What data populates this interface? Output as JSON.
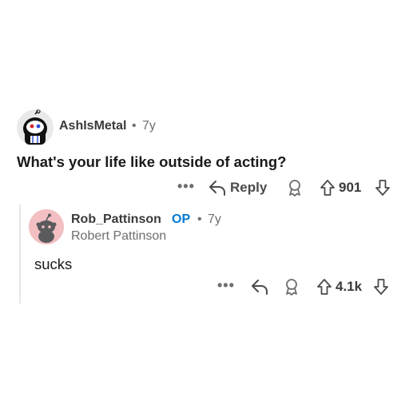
{
  "comment": {
    "author": "AshIsMetal",
    "separator": "•",
    "age": "7y",
    "body": "What's your life like outside of acting?",
    "actions": {
      "more": "•••",
      "reply_label": "Reply",
      "score": "901"
    }
  },
  "reply": {
    "author": "Rob_Pattinson",
    "op_badge": "OP",
    "separator": "•",
    "age": "7y",
    "flair": "Robert Pattinson",
    "body": "sucks",
    "actions": {
      "more": "•••",
      "score": "4.1k"
    }
  },
  "colors": {
    "op_blue": "#0079d3",
    "meta_gray": "#6e6e6e",
    "avatar_pink": "#f3bfc3",
    "thread_line": "#e6e6e6"
  },
  "icons": {
    "reply": "reply-arrow-icon",
    "award": "award-icon",
    "upvote": "upvote-arrow-icon",
    "downvote": "downvote-arrow-icon"
  }
}
